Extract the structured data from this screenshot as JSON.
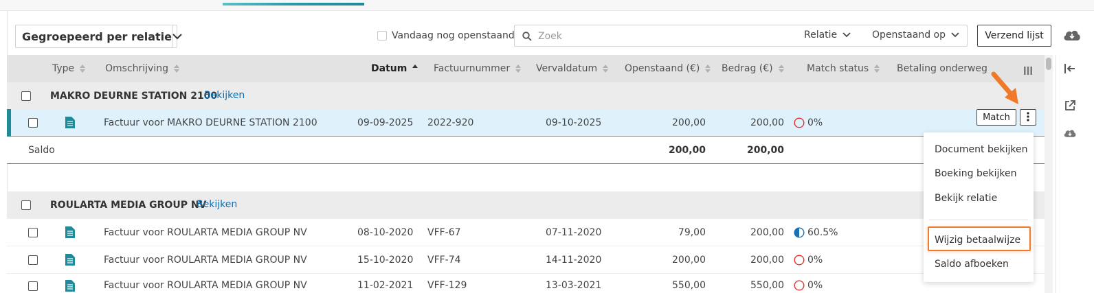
{
  "toolbar": {
    "group_by": "Gegroepeerd per relatie",
    "today_open_label": "Vandaag nog openstaand",
    "search_placeholder": "Zoek",
    "filter_relation": "Relatie",
    "filter_open_on": "Openstaand op",
    "send_list": "Verzend lijst"
  },
  "columns": [
    "Type",
    "Omschrijving",
    "Datum",
    "Factuurnummer",
    "Vervaldatum",
    "Openstaand (€)",
    "Bedrag (€)",
    "Match status",
    "Betaling onderweg"
  ],
  "groups": [
    {
      "name": "MAKRO DEURNE STATION 2100",
      "view_link": "Bekijken",
      "rows": [
        {
          "description": "Factuur voor MAKRO DEURNE STATION 2100",
          "date": "09-09-2025",
          "invoice": "2022-920",
          "due": "09-10-2025",
          "open": "200,00",
          "amount": "200,00",
          "match": "0%",
          "match_fraction": 0
        }
      ],
      "saldo_label": "Saldo",
      "saldo_open": "200,00",
      "saldo_amount": "200,00"
    },
    {
      "name": "ROULARTA MEDIA GROUP NV",
      "view_link": "Bekijken",
      "rows": [
        {
          "description": "Factuur voor ROULARTA MEDIA GROUP NV",
          "date": "08-10-2020",
          "invoice": "VFF-67",
          "due": "07-11-2020",
          "open": "79,00",
          "amount": "200,00",
          "match": "60.5%",
          "match_fraction": 0.605
        },
        {
          "description": "Factuur voor ROULARTA MEDIA GROUP NV",
          "date": "15-10-2020",
          "invoice": "VFF-74",
          "due": "14-11-2020",
          "open": "200,00",
          "amount": "200,00",
          "match": "0%",
          "match_fraction": 0
        },
        {
          "description": "Factuur voor ROULARTA MEDIA GROUP NV",
          "date": "11-02-2021",
          "invoice": "VFF-129",
          "due": "13-03-2021",
          "open": "550,00",
          "amount": "550,00",
          "match": "0%",
          "match_fraction": 0
        }
      ]
    }
  ],
  "row_actions": {
    "match": "Match"
  },
  "context_menu": {
    "items": [
      "Document bekijken",
      "Boeking bekijken",
      "Bekijk relatie",
      "Wijzig betaalwijze",
      "Saldo afboeken"
    ],
    "highlighted_index": 3
  },
  "colors": {
    "accent": "#1f8b99",
    "link": "#0a6eb4",
    "selected_row": "#dff1fb",
    "highlight": "#f07a2a",
    "status_none": "#e0312f",
    "status_partial": "#1a6fb5"
  },
  "icons": [
    "cloud-download-icon",
    "search-icon",
    "chevron-down-icon",
    "sort-icon",
    "columns-icon",
    "document-icon",
    "kebab-icon",
    "arrow-pointer-icon",
    "collapse-left-icon",
    "external-link-icon"
  ]
}
